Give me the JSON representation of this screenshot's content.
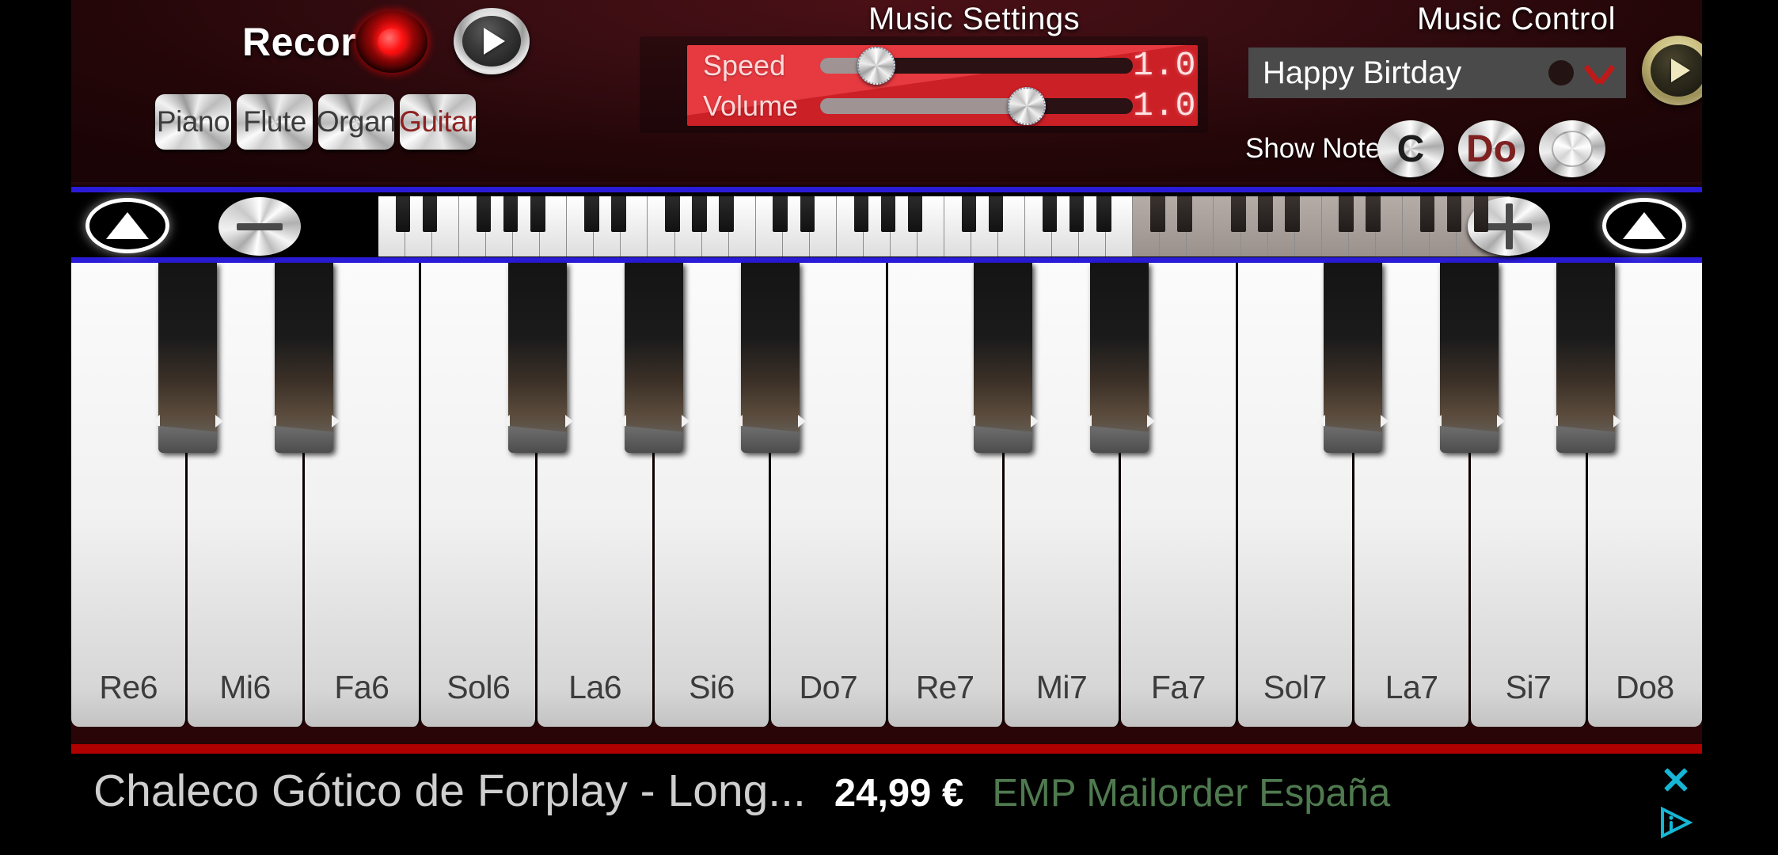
{
  "record": {
    "label": "Record",
    "record_button_icon": "record-dot-icon",
    "play_button_icon": "play-triangle-icon"
  },
  "instruments": {
    "items": [
      {
        "label": "Piano",
        "selected": false
      },
      {
        "label": "Flute",
        "selected": false
      },
      {
        "label": "Organ",
        "selected": false
      },
      {
        "label": "Guitar",
        "selected": true
      }
    ],
    "selected": "Guitar"
  },
  "music_settings": {
    "title": "Music Settings",
    "sliders": [
      {
        "name": "speed",
        "label": "Speed",
        "value": "1.0",
        "fill_percent": 18,
        "knob_percent": 18
      },
      {
        "name": "volume",
        "label": "Volume",
        "value": "1.0",
        "fill_percent": 66,
        "knob_percent": 66
      }
    ]
  },
  "music_control": {
    "title": "Music Control",
    "song": "Happy Birtday",
    "dropdown_icon": "chevron-down-icon",
    "play_icon": "play-triangle-icon",
    "show_notes_label": "Show Notes",
    "note_modes": [
      {
        "name": "letter",
        "label": "C",
        "selected": false
      },
      {
        "name": "solfege",
        "label": "Do",
        "selected": true
      },
      {
        "name": "off",
        "label": "",
        "selected": false
      }
    ]
  },
  "navigation": {
    "scroll_left_icon": "arrow-up-icon",
    "zoom_out_label": "—",
    "zoom_in_label": "+",
    "scroll_right_icon": "arrow-up-icon"
  },
  "keyboard": {
    "white_keys": [
      "Re6",
      "Mi6",
      "Fa6",
      "Sol6",
      "La6",
      "Si6",
      "Do7",
      "Re7",
      "Mi7",
      "Fa7",
      "Sol7",
      "La7",
      "Si7",
      "Do8"
    ],
    "black_key_positions": [
      0,
      1,
      3,
      4,
      5,
      7,
      8,
      10,
      11,
      12
    ]
  },
  "ad": {
    "title": "Chaleco Gótico de Forplay - Long...",
    "price": "24,99 €",
    "advertiser": "EMP Mailorder España",
    "close_icon": "close-x-icon",
    "adchoices_icon": "adchoices-info-icon"
  },
  "colors": {
    "panel_red": "#3a0d12",
    "slider_red": "#e3242b",
    "accent_blue": "#2a1bd8",
    "selected_instrument": "#8d2222",
    "ad_green": "#4f7a4f",
    "ad_cyan": "#15b6d6"
  }
}
